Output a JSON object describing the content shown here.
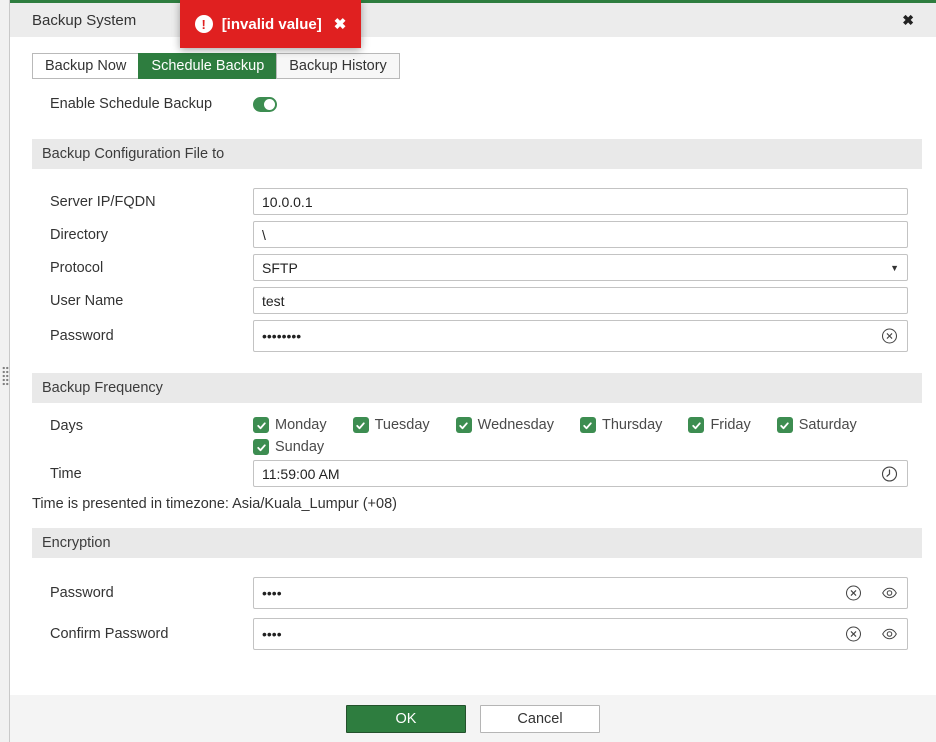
{
  "colors": {
    "accent_green": "#2e7d3f",
    "checkbox_green": "#3d8d51",
    "error_red": "#e02020"
  },
  "panel": {
    "title": "Backup System",
    "close_icon": "✖"
  },
  "toast": {
    "message": "[invalid value]",
    "close_icon": "✖",
    "error_glyph": "!"
  },
  "tabs": [
    {
      "label": "Backup Now"
    },
    {
      "label": "Schedule Backup"
    },
    {
      "label": "Backup History"
    }
  ],
  "enable_toggle": {
    "label": "Enable Schedule Backup",
    "state": "on"
  },
  "destination": {
    "heading": "Backup Configuration File to",
    "server_label": "Server IP/FQDN",
    "server_value": "10.0.0.1",
    "directory_label": "Directory",
    "directory_value": "\\",
    "protocol_label": "Protocol",
    "protocol_value": "SFTP",
    "username_label": "User Name",
    "username_value": "test",
    "password_label": "Password",
    "password_value": "••••••••"
  },
  "frequency": {
    "heading": "Backup Frequency",
    "days_label": "Days",
    "days": [
      "Monday",
      "Tuesday",
      "Wednesday",
      "Thursday",
      "Friday",
      "Saturday",
      "Sunday"
    ],
    "days_checked": [
      true,
      true,
      true,
      true,
      true,
      true,
      true
    ],
    "time_label": "Time",
    "time_value": "11:59:00 AM",
    "timezone_note": "Time is presented in timezone: Asia/Kuala_Lumpur (+08)"
  },
  "encryption": {
    "heading": "Encryption",
    "password_label": "Password",
    "password_value": "••••",
    "confirm_label": "Confirm Password",
    "confirm_value": "••••"
  },
  "footer": {
    "ok_label": "OK",
    "cancel_label": "Cancel"
  }
}
